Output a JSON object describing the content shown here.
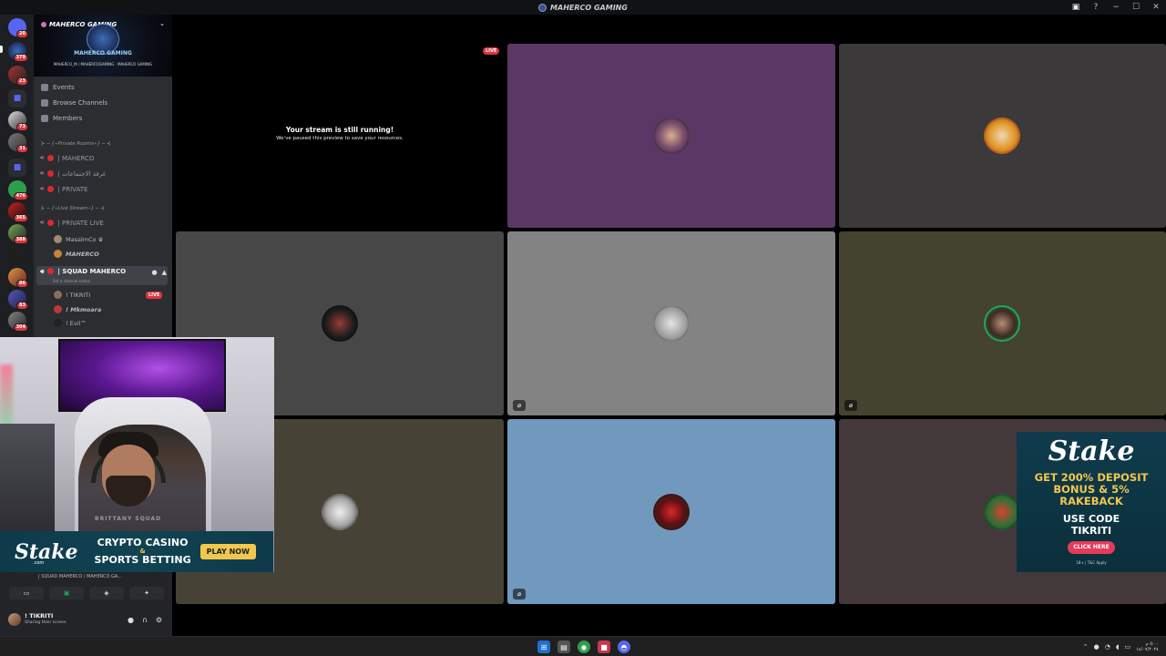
{
  "window": {
    "title": "MAHERCO GAMING",
    "controls": [
      "−",
      "☐",
      "✕"
    ]
  },
  "server": {
    "name": "MAHERCO GAMING",
    "banner_title": "MAHERCO GAMING",
    "banner_handles": "MAHERCO_M / MAHERCOGAMING · MAHERCO GAMING"
  },
  "rail_badges": [
    "20",
    "379",
    "23",
    "73",
    "31",
    "476",
    "365",
    "388",
    "86",
    "83",
    "304"
  ],
  "nav": {
    "events": "Events",
    "browse": "Browse Channels",
    "members": "Members"
  },
  "categories": {
    "private_rooms": "⊱ ─ {⋆Private Rooms⋆} ─ ⊰",
    "live_stream": "⊱ ─ {⋆Live Stream⋆} ─ ⊰"
  },
  "channels": {
    "maherco": "| MAHERCO",
    "meetings": "| غرفة الاجتماعات",
    "private": "| PRIVATE",
    "private_live": "| PRIVATE LIVE",
    "squad": "| SQUAD MAHERCO",
    "squad_status": "Set a channel status"
  },
  "members": {
    "masalmco": "MasalmCo ♛",
    "maherco": "MAHERCO",
    "tikriti": "! TIKRITI",
    "mkmoara": "! Mkmoara",
    "evil": "! Evil™"
  },
  "live_label": "LIVE",
  "stream": {
    "heading": "Your stream is still running!",
    "sub": "We've paused this preview to save your resources."
  },
  "tiles": {
    "colors": [
      "#5a3764",
      "#3b393a",
      "#474747",
      "#838383",
      "#44432f",
      "#464336",
      "#7199bd",
      "#43393b"
    ]
  },
  "webcam": {
    "shirt": "BRITTANY SQUAD"
  },
  "ad_strip": {
    "brand": "Stake",
    "dotcom": ".com",
    "line1": "CRYPTO CASINO",
    "amp": "&",
    "line2": "SPORTS BETTING",
    "cta": "PLAY NOW"
  },
  "ad_right": {
    "brand": "Stake",
    "offer1": "GET 200% DEPOSIT",
    "offer2": "BONUS & 5%",
    "offer3": "RAKEBACK",
    "code1": "USE CODE",
    "code2": "TIKRITI",
    "cta": "CLICK HERE",
    "fine": "18+ | T&C Apply"
  },
  "voice_panel": {
    "link": "| SQUAD MAHERCO / MAHERCO GA...",
    "user": "! TIKRITI",
    "status": "Sharing their screen"
  },
  "taskbar": {
    "time": "٥:٠٠ م",
    "date": "١٤/٠٧/٢٠٢٤"
  }
}
